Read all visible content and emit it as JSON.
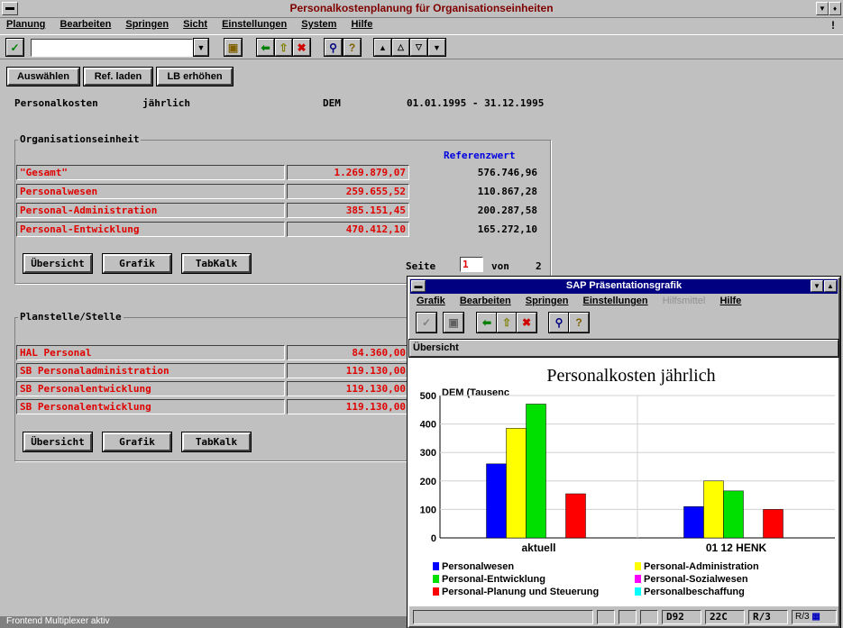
{
  "window": {
    "title": "Personalkostenplanung für Organisationseinheiten",
    "controls": [
      "▼",
      "♦"
    ]
  },
  "menu": [
    "Planung",
    "Bearbeiten",
    "Springen",
    "Sicht",
    "Einstellungen",
    "System",
    "Hilfe"
  ],
  "menu_right": "!",
  "command_field": {
    "value": "",
    "placeholder": ""
  },
  "app_buttons": [
    "Auswählen",
    "Ref. laden",
    "LB erhöhen"
  ],
  "header_line": {
    "label": "Personalkosten",
    "period": "jährlich",
    "currency": "DEM",
    "range": "01.01.1995 - 31.12.1995"
  },
  "org_section": {
    "title": "Organisationseinheit",
    "ref_header": "Referenzwert",
    "rows": [
      {
        "name": "\"Gesamt\"",
        "value": "1.269.879,07",
        "ref": "576.746,96"
      },
      {
        "name": "Personalwesen",
        "value": "259.655,52",
        "ref": "110.867,28"
      },
      {
        "name": "Personal-Administration",
        "value": "385.151,45",
        "ref": "200.287,58"
      },
      {
        "name": "Personal-Entwicklung",
        "value": "470.412,10",
        "ref": "165.272,10"
      }
    ],
    "buttons": [
      "Übersicht",
      "Grafik",
      "TabKalk"
    ],
    "page_label": "Seite",
    "page_value": "1",
    "page_of": "von",
    "page_total": "2"
  },
  "stelle_section": {
    "title": "Planstelle/Stelle",
    "rows": [
      {
        "name": "HAL Personal",
        "value": "84.360,00"
      },
      {
        "name": "SB Personaladministration",
        "value": "119.130,00"
      },
      {
        "name": "SB Personalentwicklung",
        "value": "119.130,00"
      },
      {
        "name": "SB Personalentwicklung",
        "value": "119.130,00"
      }
    ],
    "buttons": [
      "Übersicht",
      "Grafik",
      "TabKalk"
    ]
  },
  "status_bar": {
    "text": "Frontend Multiplexer aktiv"
  },
  "graphic_window": {
    "title": "SAP Präsentationsgrafik",
    "menu": [
      "Grafik",
      "Bearbeiten",
      "Springen",
      "Einstellungen",
      "Hilfsmittel",
      "Hilfe"
    ],
    "tab": "Übersicht",
    "status": [
      "D92",
      "22C",
      "R/3",
      "R/3"
    ]
  },
  "chart_data": {
    "type": "bar",
    "title": "Personalkosten jährlich",
    "ylabel": "DEM (Tausenc",
    "ylim": [
      0,
      500
    ],
    "yticks": [
      0,
      100,
      200,
      300,
      400,
      500
    ],
    "categories": [
      "aktuell",
      "01 12 HENK"
    ],
    "series": [
      {
        "name": "Personalwesen",
        "color": "#0000ff",
        "values": [
          260,
          110
        ]
      },
      {
        "name": "Personal-Administration",
        "color": "#ffff00",
        "values": [
          385,
          200
        ]
      },
      {
        "name": "Personal-Entwicklung",
        "color": "#00e000",
        "values": [
          470,
          165
        ]
      },
      {
        "name": "Personal-Planung und Steuerung",
        "color": "#ff0000",
        "values": [
          155,
          100
        ]
      },
      {
        "name": "Personal-Sozialwesen",
        "color": "#ff00ff",
        "values": [
          null,
          null
        ]
      },
      {
        "name": "Personalbeschaffung",
        "color": "#00ffff",
        "values": [
          null,
          null
        ]
      }
    ],
    "grid": true,
    "legend": "bottom"
  },
  "colors": {
    "titlebar_text": "#7f0000",
    "value_red": "#e00000",
    "ref_blue": "#0000e0",
    "active_title": "#000080"
  }
}
